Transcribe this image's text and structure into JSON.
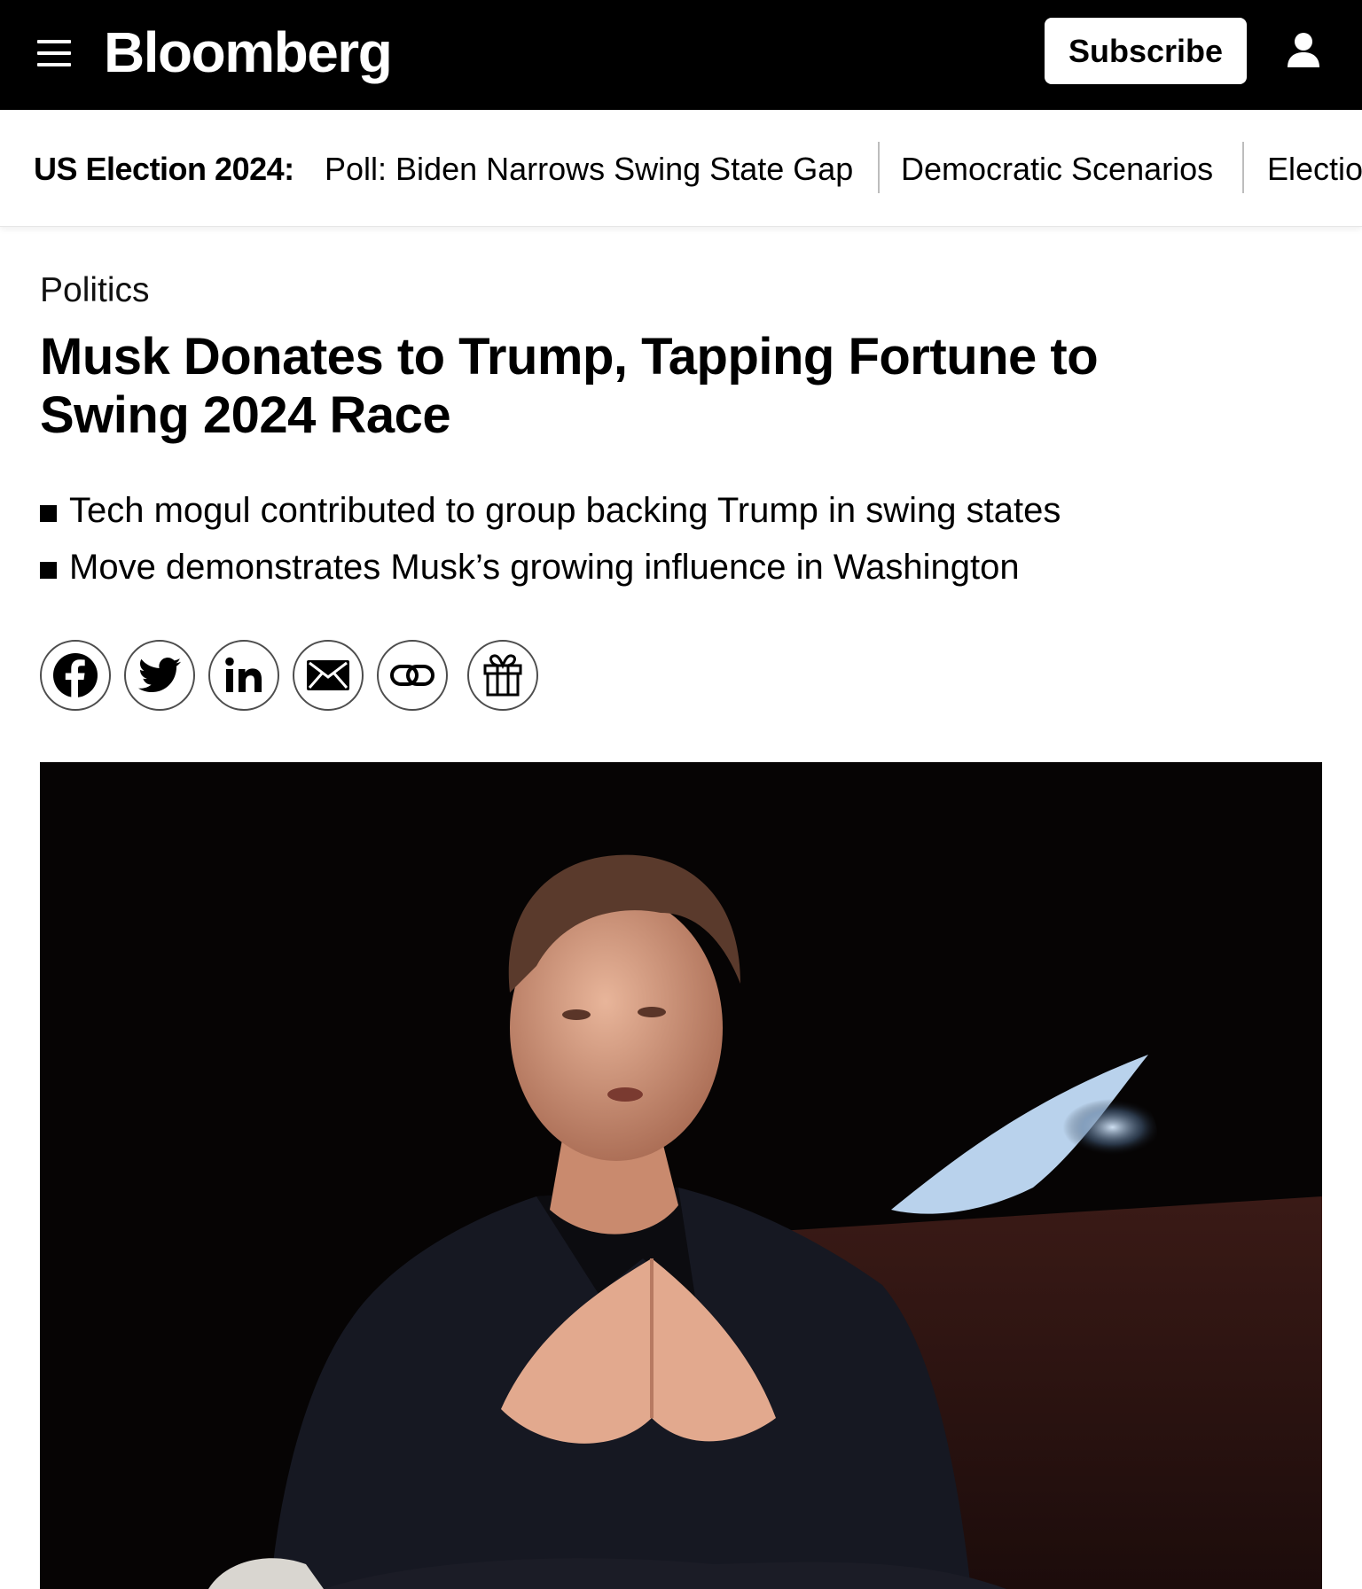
{
  "header": {
    "logo": "Bloomberg",
    "subscribe_label": "Subscribe"
  },
  "ticker": {
    "label": "US Election 2024:",
    "links": [
      "Poll: Biden Narrows Swing State Gap",
      "Democratic Scenarios",
      "Electio"
    ]
  },
  "article": {
    "kicker": "Politics",
    "headline_line1": "Musk Donates to Trump, Tapping Fortune to",
    "headline_line2": "Swing 2024 Race",
    "bullets": [
      "Tech mogul contributed to group backing Trump in swing states",
      "Move demonstrates Musk’s growing influence in Washington"
    ]
  },
  "share": {
    "icons": [
      "facebook-icon",
      "twitter-icon",
      "linkedin-icon",
      "email-icon",
      "link-icon",
      "gift-icon"
    ]
  },
  "colors": {
    "topbar": "#000000",
    "text": "#000000",
    "photo_bg": "#060404"
  }
}
